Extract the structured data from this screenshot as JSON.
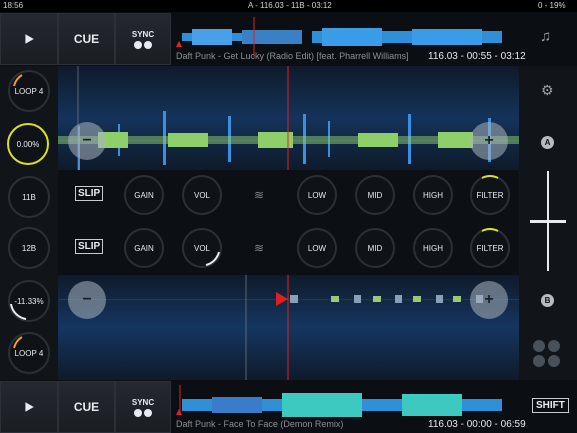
{
  "status": {
    "time": "18:56",
    "center": "A - 116.03 - 11B - 03:12",
    "right": "0 - 19%"
  },
  "deckA": {
    "play_icon": "play-icon",
    "cue_label": "CUE",
    "sync_label": "SYNC",
    "track": "Daft Punk - Get Lucky (Radio Edit) [feat. Pharrell Williams]",
    "info": "116.03 - 00:55 - 03:12",
    "loop_label": "LOOP 4",
    "pitch": "0.00%",
    "key": "11B",
    "badge": "A",
    "nudge_minus": "−",
    "nudge_plus": "+"
  },
  "deckB": {
    "play_icon": "play-icon",
    "cue_label": "CUE",
    "sync_label": "SYNC",
    "track": "Daft Punk - Face To Face (Demon Remix)",
    "info": "116.03 - 00:00 - 06:59",
    "loop_label": "LOOP 4",
    "pitch": "-11.33%",
    "key": "12B",
    "badge": "B",
    "nudge_minus": "−",
    "nudge_plus": "+"
  },
  "fxA": {
    "slip": "SLIP",
    "gain": "GAIN",
    "vol": "VOL",
    "low": "LOW",
    "mid": "MID",
    "high": "HIGH",
    "filter": "FILTER"
  },
  "fxB": {
    "slip": "SLIP",
    "gain": "GAIN",
    "vol": "VOL",
    "low": "LOW",
    "mid": "MID",
    "high": "HIGH",
    "filter": "FILTER"
  },
  "shift_label": "SHIFT",
  "colors": {
    "accent_yellow": "#d7e21a",
    "accent_orange": "#f0a020",
    "cue_red": "#e02020",
    "wave_blue": "#3a8fe0"
  },
  "icons": {
    "music": "music-note-icon",
    "settings": "gear-icon",
    "grid": "pads-grid-icon",
    "crossfader": "crossfader-icon",
    "eq_wave": "wave-icon"
  }
}
